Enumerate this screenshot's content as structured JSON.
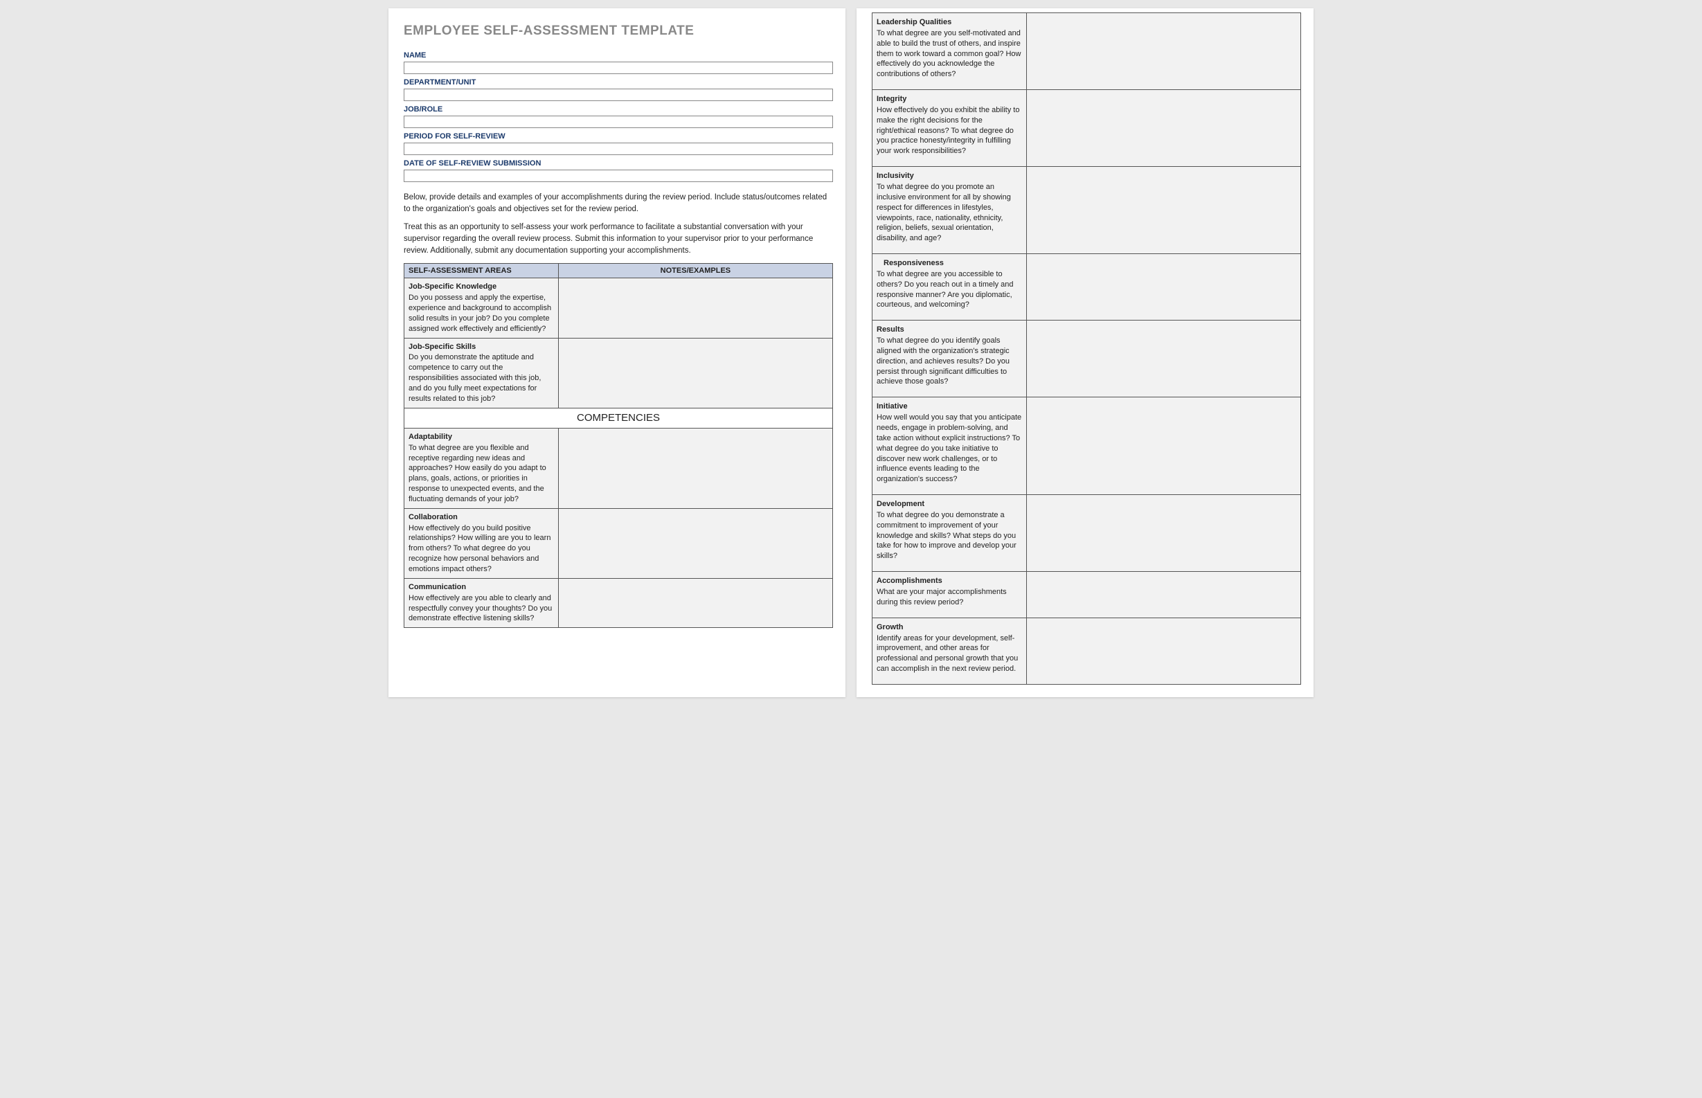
{
  "title": "EMPLOYEE SELF-ASSESSMENT TEMPLATE",
  "fields": {
    "name": {
      "label": "NAME",
      "value": ""
    },
    "department": {
      "label": "DEPARTMENT/UNIT",
      "value": ""
    },
    "job": {
      "label": "JOB/ROLE",
      "value": ""
    },
    "period": {
      "label": "PERIOD FOR SELF-REVIEW",
      "value": ""
    },
    "date": {
      "label": "DATE OF SELF-REVIEW SUBMISSION",
      "value": ""
    }
  },
  "intro": {
    "p1": "Below, provide details and examples of your accomplishments during the review period. Include status/outcomes related to the organization's goals and objectives set for the review period.",
    "p2": "Treat this as an opportunity to self-assess your work performance to facilitate a substantial conversation with your supervisor regarding the overall review process. Submit this information to your supervisor prior to your performance review. Additionally, submit any documentation supporting your accomplishments."
  },
  "table": {
    "header_areas": "SELF-ASSESSMENT AREAS",
    "header_notes": "NOTES/EXAMPLES",
    "competencies_header": "COMPETENCIES",
    "rows_page1_top": [
      {
        "title": "Job-Specific Knowledge",
        "desc": "Do you possess and apply the expertise, experience and background to accomplish solid results in your job? Do you complete assigned work effectively and efficiently?"
      },
      {
        "title": "Job-Specific Skills",
        "desc": "Do you demonstrate the aptitude and competence to carry out the responsibilities associated with this job, and do you fully meet expectations for results related to this job?"
      }
    ],
    "rows_page1_comp": [
      {
        "title": "Adaptability",
        "desc": "To what degree are you flexible and receptive regarding new ideas and approaches? How easily do you adapt to plans, goals, actions, or priorities in response to unexpected events, and the fluctuating demands of your job?"
      },
      {
        "title": "Collaboration",
        "desc": "How effectively do you build positive relationships? How willing are you to learn from others? To what degree do you recognize how personal behaviors and emotions impact others?"
      },
      {
        "title": "Communication",
        "desc": "How effectively are you able to clearly and respectfully convey your thoughts? Do you demonstrate effective listening skills?"
      }
    ],
    "rows_page2": [
      {
        "title": "Leadership Qualities",
        "desc": "To what degree are you self-motivated and able to build the trust of others, and inspire them to work toward a common goal? How effectively do you acknowledge the contributions of others?"
      },
      {
        "title": "Integrity",
        "desc": "How effectively do you exhibit the ability to make the right decisions for the right/ethical reasons? To what degree do you practice honesty/integrity in fulfilling your work responsibilities?"
      },
      {
        "title": "Inclusivity",
        "desc": "To what degree do you promote an inclusive environment for all by showing respect for differences in lifestyles, viewpoints, race, nationality, ethnicity, religion, beliefs, sexual orientation, disability, and age?"
      },
      {
        "title": "Responsiveness",
        "desc": "To what degree are you accessible to others? Do you reach out in a timely and responsive manner? Are you diplomatic, courteous, and welcoming?",
        "indent": true
      },
      {
        "title": "Results",
        "desc": "To what degree do you identify goals aligned with the organization's strategic direction, and achieves results? Do you persist through significant difficulties to achieve those goals?"
      },
      {
        "title": "Initiative",
        "desc": "How well would you say that you anticipate needs, engage in problem-solving, and take action without explicit instructions? To what degree do you take initiative to discover new work challenges, or to influence events leading to the organization's success?"
      },
      {
        "title": "Development",
        "desc": "To what degree do you demonstrate a commitment to improvement of your knowledge and skills? What steps do you take for how to improve and develop your skills?"
      },
      {
        "title": "Accomplishments",
        "desc": "What are your major accomplishments during this review period?"
      },
      {
        "title": "Growth",
        "desc": "Identify areas for your development, self-improvement, and other areas for professional and personal growth that you can accomplish in the next review period."
      }
    ]
  }
}
